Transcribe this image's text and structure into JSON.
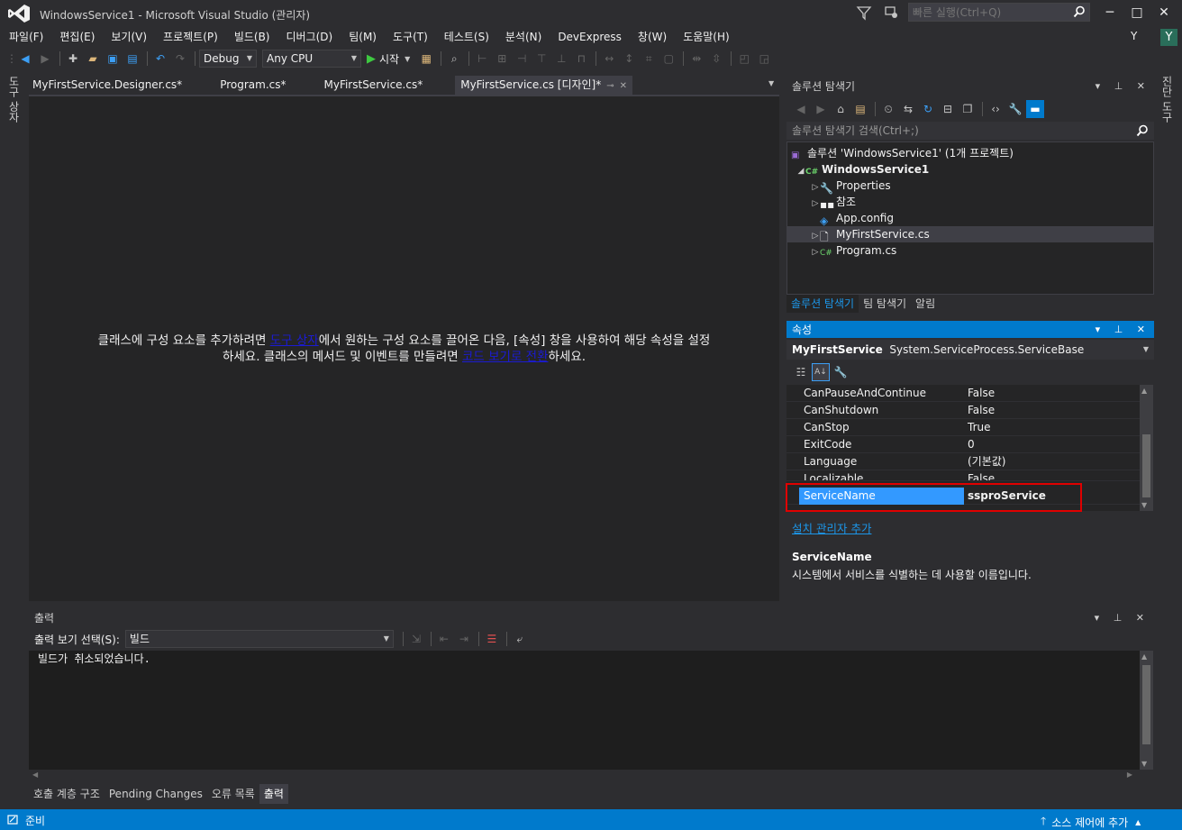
{
  "window": {
    "title": "WindowsService1 - Microsoft Visual Studio  (관리자)",
    "quick_launch_placeholder": "빠른 실행(Ctrl+Q)",
    "minimize": "─",
    "maximize": "□",
    "close": "✕",
    "user_initial": "Y",
    "user_avatar": "Y"
  },
  "menu": [
    "파일(F)",
    "편집(E)",
    "보기(V)",
    "프로젝트(P)",
    "빌드(B)",
    "디버그(D)",
    "팀(M)",
    "도구(T)",
    "테스트(S)",
    "분석(N)",
    "DevExpress",
    "창(W)",
    "도움말(H)"
  ],
  "toolbar": {
    "config": "Debug",
    "platform": "Any CPU",
    "start_label": "시작"
  },
  "side_labels": {
    "left": "도구 상자",
    "right": "진단 도구"
  },
  "doc_tabs": [
    {
      "label": "MyFirstService.Designer.cs*"
    },
    {
      "label": "Program.cs*"
    },
    {
      "label": "MyFirstService.cs*"
    },
    {
      "label": "MyFirstService.cs [디자인]*"
    }
  ],
  "designer": {
    "msg_part1": "클래스에 구성 요소를 추가하려면 ",
    "toolbox_link": "도구 상자",
    "msg_part2": "에서 원하는 구성 요소를 끌어온 다음, [속성] 창을 사용하여 해당 속성을 설정",
    "msg_part3": "하세요. 클래스의 메서드 및 이벤트를 만들려면 ",
    "code_link": "코드 보기로 전환",
    "msg_part4": "하세요."
  },
  "solution_explorer": {
    "title": "솔루션 탐색기",
    "search_placeholder": "솔루션 탐색기 검색(Ctrl+;)",
    "tree": [
      {
        "label": "솔루션 'WindowsService1' (1개 프로젝트)"
      },
      {
        "label": "WindowsService1"
      },
      {
        "label": "Properties"
      },
      {
        "label": "참조"
      },
      {
        "label": "App.config"
      },
      {
        "label": "MyFirstService.cs"
      },
      {
        "label": "Program.cs"
      }
    ],
    "tabs": [
      "솔루션 탐색기",
      "팀 탐색기",
      "알림"
    ]
  },
  "properties": {
    "title": "속성",
    "object_name": "MyFirstService",
    "object_type": "System.ServiceProcess.ServiceBase",
    "rows": [
      {
        "name": "CanPauseAndContinue",
        "value": "False"
      },
      {
        "name": "CanShutdown",
        "value": "False"
      },
      {
        "name": "CanStop",
        "value": "True"
      },
      {
        "name": "ExitCode",
        "value": "0"
      },
      {
        "name": "Language",
        "value": "(기본값)"
      },
      {
        "name": "Localizable",
        "value": "False"
      },
      {
        "name": "ServiceName",
        "value": "ssproService"
      }
    ],
    "add_installer_link": "설치 관리자 추가",
    "desc_title": "ServiceName",
    "desc_text": "시스템에서 서비스를 식별하는 데 사용할 이름입니다."
  },
  "output": {
    "title": "출력",
    "show_from_label": "출력 보기 선택(S):",
    "show_from_value": "빌드",
    "text": "빌드가 취소되었습니다."
  },
  "bottom_tabs": [
    "호출 계층 구조",
    "Pending Changes",
    "오류 목록",
    "출력"
  ],
  "status": {
    "text": "준비",
    "source_control": "소스 제어에 추가"
  }
}
